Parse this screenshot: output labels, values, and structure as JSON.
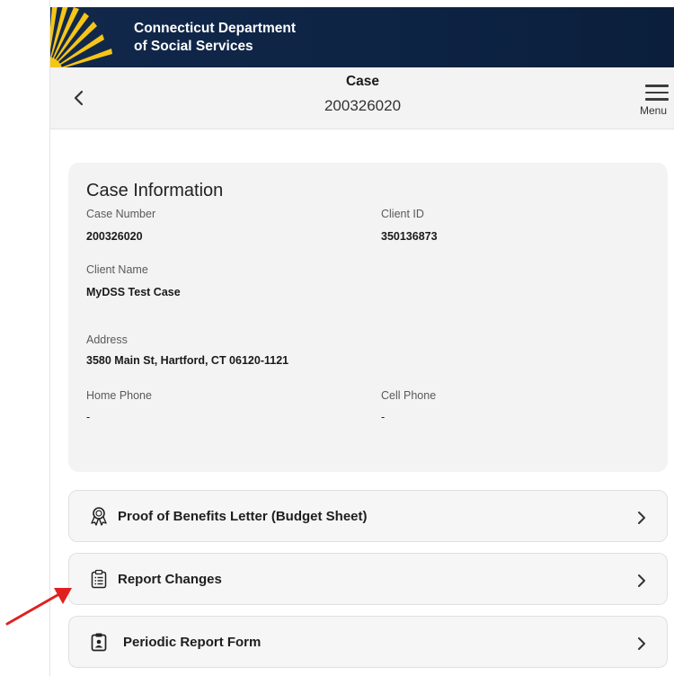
{
  "header": {
    "agency_line1": "Connecticut Department",
    "agency_line2": "of Social Services",
    "logo_icon": "sunburst-logo"
  },
  "topbar": {
    "title": "Case",
    "case_number": "200326020",
    "menu_label": "Menu",
    "back_icon": "chevron-left-icon",
    "menu_icon": "hamburger-icon"
  },
  "case_info": {
    "heading": "Case Information",
    "case_number_label": "Case Number",
    "case_number_value": "200326020",
    "client_id_label": "Client ID",
    "client_id_value": "350136873",
    "client_name_label": "Client Name",
    "client_name_value": "MyDSS Test Case",
    "address_label": "Address",
    "address_value": "3580 Main St, Hartford, CT 06120-1121",
    "home_phone_label": "Home Phone",
    "home_phone_value": "-",
    "cell_phone_label": "Cell Phone",
    "cell_phone_value": "-"
  },
  "actions": [
    {
      "label": "Proof of Benefits Letter (Budget Sheet)",
      "icon": "award-ribbon-icon"
    },
    {
      "label": "Report Changes",
      "icon": "clipboard-list-icon"
    },
    {
      "label": "Periodic Report Form",
      "icon": "clipboard-user-icon"
    }
  ],
  "colors": {
    "header_bg": "#0d2343",
    "sun_yellow": "#f5c518",
    "card_bg": "#f3f3f3",
    "annotation_arrow": "#e02020"
  }
}
